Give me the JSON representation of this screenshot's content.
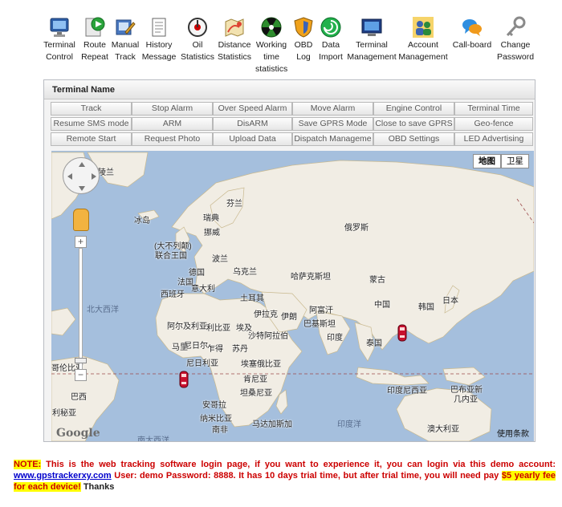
{
  "toolbar": {
    "items": [
      {
        "label": "Terminal\nControl",
        "icon": "monitor-icon"
      },
      {
        "label": "Route\nRepeat",
        "icon": "play-icon"
      },
      {
        "label": "Manual\nTrack",
        "icon": "pen-icon"
      },
      {
        "label": "History\nMessage",
        "icon": "document-icon"
      },
      {
        "label": "Oil\nStatistics",
        "icon": "oil-gauge-icon"
      },
      {
        "label": "Distance\nStatistics",
        "icon": "route-map-icon"
      },
      {
        "label": "Working\ntime\nstatistics",
        "icon": "radiation-icon"
      },
      {
        "label": "OBD\nLog",
        "icon": "shield-icon"
      },
      {
        "label": "Data\nImport",
        "icon": "swirl-icon"
      },
      {
        "label": "Terminal\nManagement",
        "icon": "terminal-screen-icon"
      },
      {
        "label": "Account\nManagement",
        "icon": "users-icon"
      },
      {
        "label": "Call-board",
        "icon": "chat-bubbles-icon"
      },
      {
        "label": "Change\nPassword",
        "icon": "key-icon"
      }
    ]
  },
  "panel": {
    "title": "Terminal Name",
    "commands": [
      [
        "Track",
        "Stop Alarm",
        "Over Speed Alarm",
        "Move Alarm",
        "Engine Control",
        "Terminal Time"
      ],
      [
        "Resume SMS mode",
        "ARM",
        "DisARM",
        "Save GPRS Mode",
        "Close to save GPRS",
        "Geo-fence"
      ],
      [
        "Remote Start",
        "Request Photo",
        "Upload Data",
        "Dispatch Manageme",
        "OBD Settings",
        "LED Advertising"
      ]
    ]
  },
  "map": {
    "type_buttons": [
      "地图",
      "卫星"
    ],
    "zoom_plus": "+",
    "zoom_minus": "−",
    "google": "Google",
    "terms": "使用条款",
    "labels": [
      {
        "text": "格陵兰",
        "kind": "land"
      },
      {
        "text": "冰岛",
        "kind": "land"
      },
      {
        "text": "芬兰",
        "kind": "land"
      },
      {
        "text": "瑞典",
        "kind": "land"
      },
      {
        "text": "挪威",
        "kind": "land"
      },
      {
        "text": "俄罗斯",
        "kind": "land"
      },
      {
        "text": "(大不列颠)",
        "kind": "land"
      },
      {
        "text": "联合王国",
        "kind": "land"
      },
      {
        "text": "德国",
        "kind": "land"
      },
      {
        "text": "波兰",
        "kind": "land"
      },
      {
        "text": "法国",
        "kind": "land"
      },
      {
        "text": "乌克兰",
        "kind": "land"
      },
      {
        "text": "意大利",
        "kind": "land"
      },
      {
        "text": "哈萨克斯坦",
        "kind": "land"
      },
      {
        "text": "蒙古",
        "kind": "land"
      },
      {
        "text": "西班牙",
        "kind": "land"
      },
      {
        "text": "土耳其",
        "kind": "land"
      },
      {
        "text": "北大西洋",
        "kind": "sea"
      },
      {
        "text": "伊拉克",
        "kind": "land"
      },
      {
        "text": "伊朗",
        "kind": "land"
      },
      {
        "text": "阿富汗",
        "kind": "land"
      },
      {
        "text": "中国",
        "kind": "land"
      },
      {
        "text": "韩国",
        "kind": "land"
      },
      {
        "text": "日本",
        "kind": "land"
      },
      {
        "text": "阿尔及利亚",
        "kind": "land"
      },
      {
        "text": "利比亚",
        "kind": "land"
      },
      {
        "text": "埃及",
        "kind": "land"
      },
      {
        "text": "沙特阿拉伯",
        "kind": "land"
      },
      {
        "text": "巴基斯坦",
        "kind": "land"
      },
      {
        "text": "印度",
        "kind": "land"
      },
      {
        "text": "泰国",
        "kind": "land"
      },
      {
        "text": "马里",
        "kind": "land"
      },
      {
        "text": "尼日尔",
        "kind": "land"
      },
      {
        "text": "乍得",
        "kind": "land"
      },
      {
        "text": "苏丹",
        "kind": "land"
      },
      {
        "text": "尼日利亚",
        "kind": "land"
      },
      {
        "text": "埃塞俄比亚",
        "kind": "land"
      },
      {
        "text": "肯尼亚",
        "kind": "land"
      },
      {
        "text": "坦桑尼亚",
        "kind": "land"
      },
      {
        "text": "印度尼西亚",
        "kind": "land"
      },
      {
        "text": "巴布亚新",
        "kind": "land"
      },
      {
        "text": "几内亚",
        "kind": "land"
      },
      {
        "text": "哥伦比亚",
        "kind": "land"
      },
      {
        "text": "巴西",
        "kind": "land"
      },
      {
        "text": "利秘亚",
        "kind": "land"
      },
      {
        "text": "安哥拉",
        "kind": "land"
      },
      {
        "text": "纳米比亚",
        "kind": "land"
      },
      {
        "text": "南非",
        "kind": "land"
      },
      {
        "text": "马达加斯加",
        "kind": "land"
      },
      {
        "text": "印度洋",
        "kind": "sea"
      },
      {
        "text": "澳大利亚",
        "kind": "land"
      },
      {
        "text": "南大西洋",
        "kind": "sea"
      }
    ],
    "vehicles": [
      {
        "name": "vehicle-africa",
        "color": "#c8102e"
      },
      {
        "name": "vehicle-china",
        "color": "#c8102e"
      }
    ]
  },
  "note": {
    "prefix": "NOTE:",
    "text1": " This is the web tracking software login page, if you want to experience it, you can login via this demo account: ",
    "link": "www.gpstrackerxy.com",
    "text2": "  User: demo Password: 8888. It has 10 days trial time, but after trial time, you will need pay ",
    "fee": "$5 yearly fee for each device!",
    "suffix": " Thanks"
  },
  "colors": {
    "ocean": "#a5bfdd",
    "land": "#f1ede4",
    "note_red": "#cc0000",
    "highlight": "#ffff00",
    "link": "#0000cc"
  }
}
